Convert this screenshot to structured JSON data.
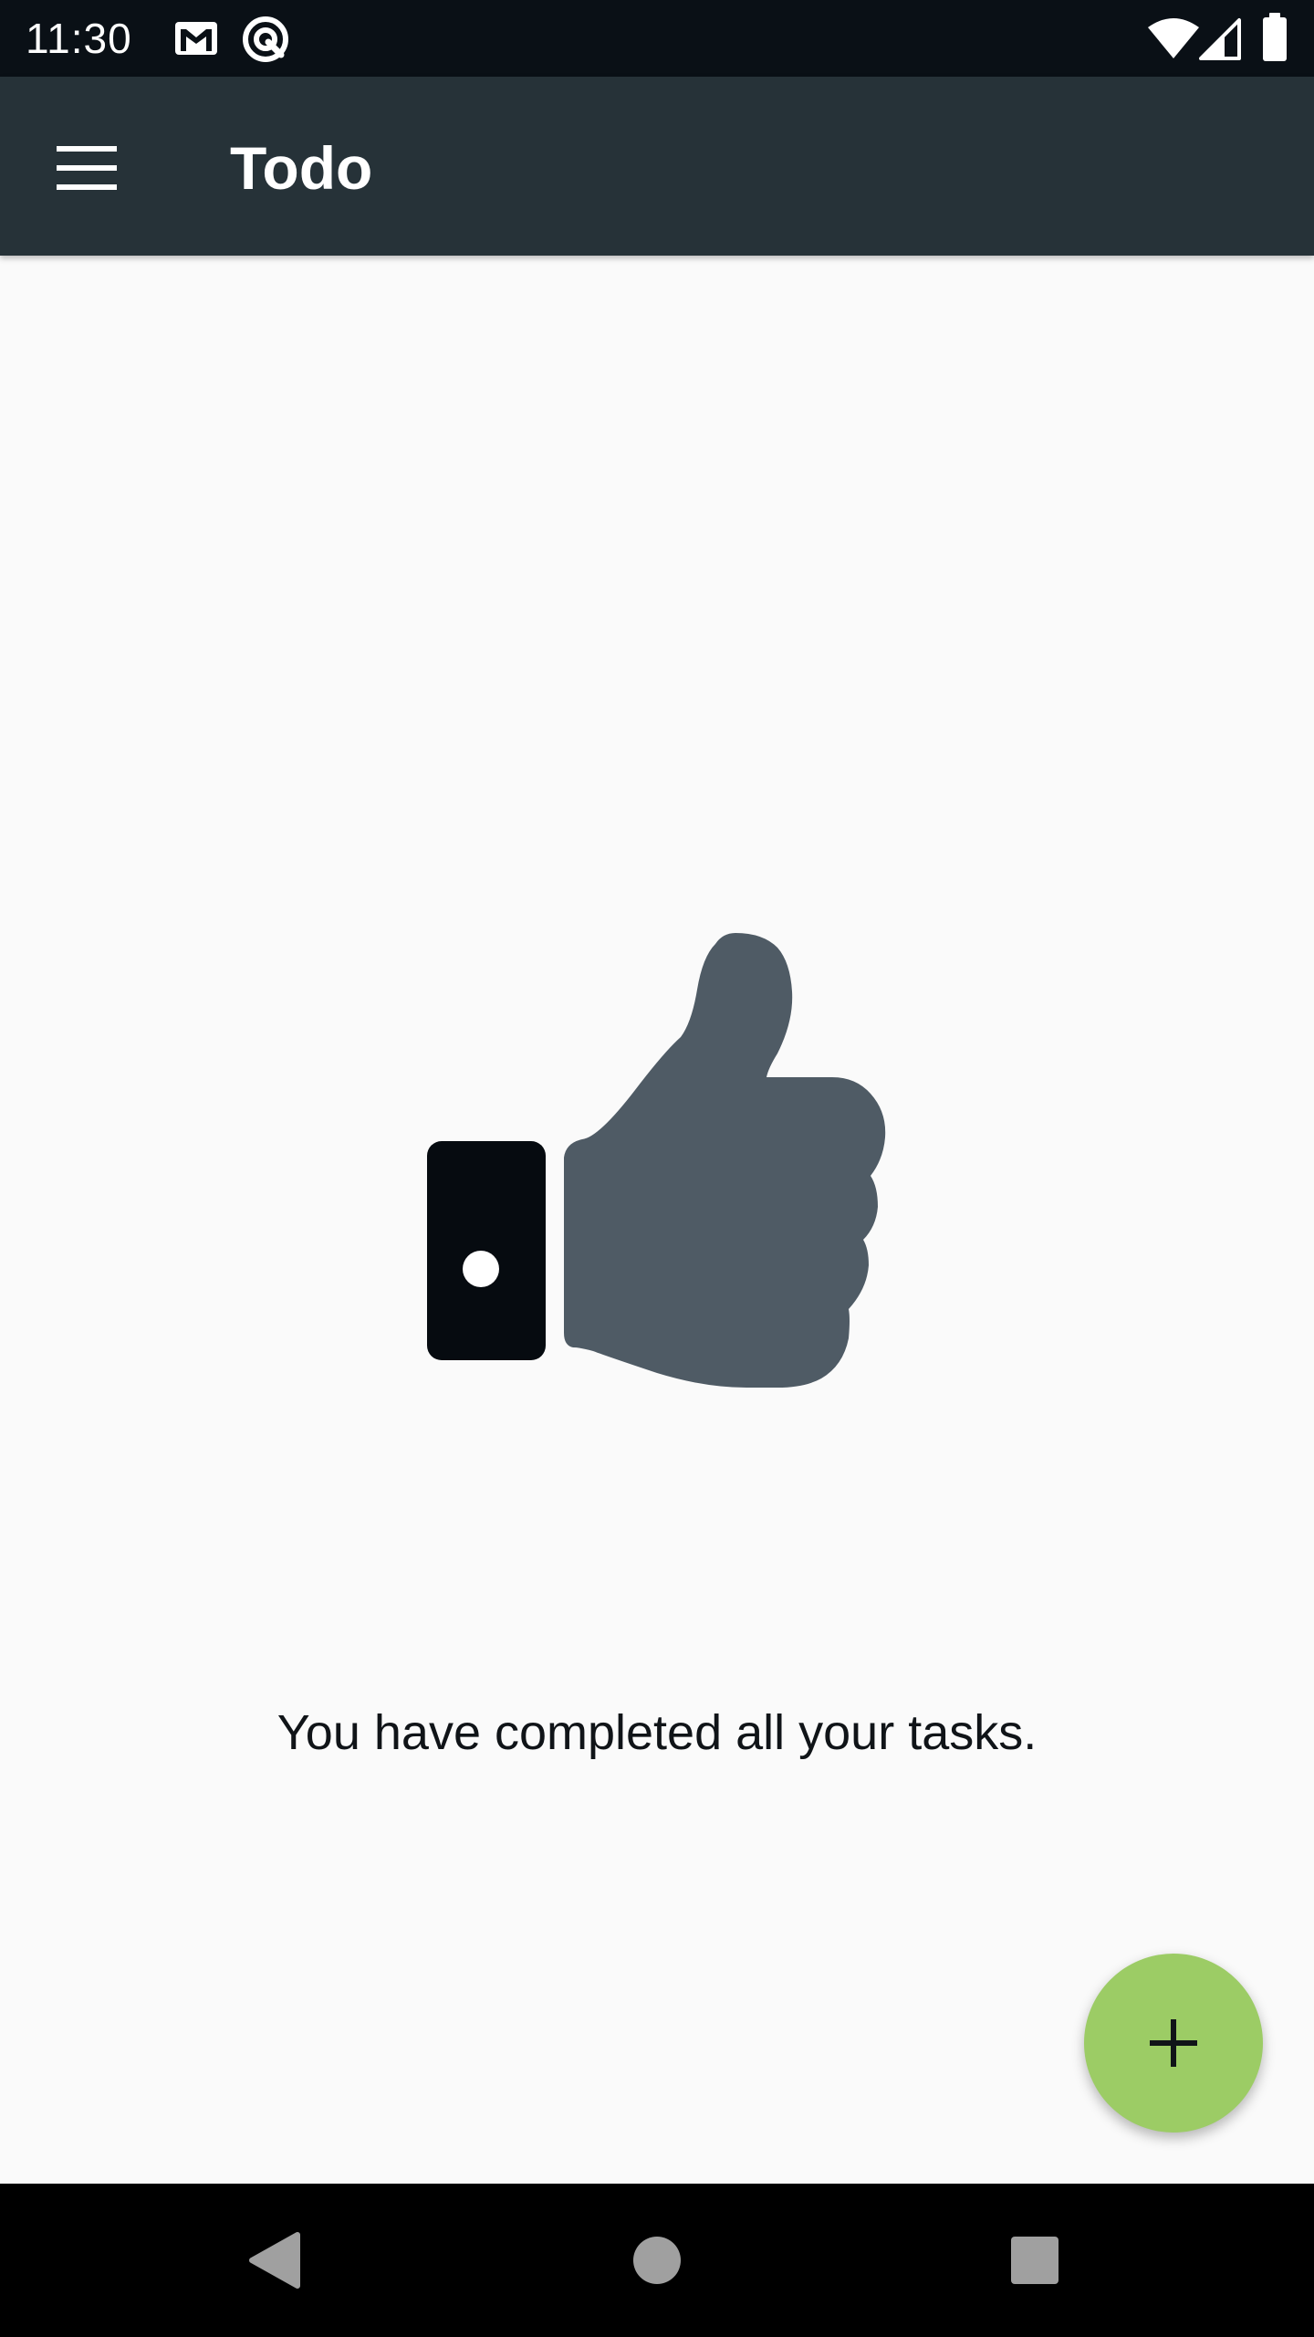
{
  "status_bar": {
    "time": "11:30",
    "left_icons": [
      "gmail-icon",
      "sync-icon"
    ],
    "right_icons": [
      "wifi-icon",
      "cell-signal-icon",
      "battery-icon"
    ]
  },
  "app_bar": {
    "title": "Todo",
    "menu_icon": "menu-icon",
    "background": "#263238"
  },
  "empty_state": {
    "icon": "thumb-up-icon",
    "message": "You have completed all your tasks."
  },
  "fab": {
    "icon": "plus-icon",
    "color": "#9ccc65"
  },
  "nav_bar": {
    "buttons": [
      "back-icon",
      "home-icon",
      "recents-icon"
    ]
  },
  "colors": {
    "background": "#fafafa",
    "thumb_hand": "#4f5b65",
    "thumb_cuff": "#060b10"
  }
}
